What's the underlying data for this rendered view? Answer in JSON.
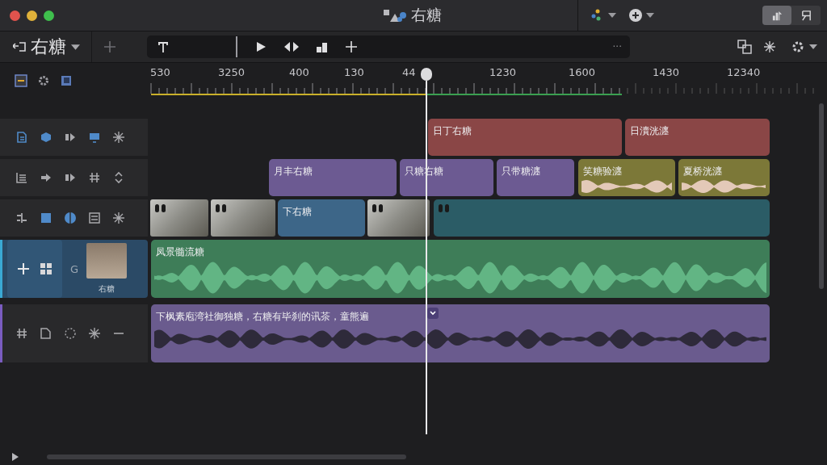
{
  "window": {
    "title": "右糖"
  },
  "title_bar": {
    "segments": [
      {
        "selected": true
      },
      {
        "selected": false
      }
    ]
  },
  "toolbar": {
    "project": "右糖",
    "more": "···"
  },
  "ruler": {
    "labels": [
      "530",
      "3250",
      "400",
      "130",
      "44",
      "1230",
      "1600",
      "1430",
      "12340"
    ]
  },
  "tracks": [
    {
      "kind": "title",
      "selected": false,
      "clips": [
        {
          "kind": "title",
          "label": "日丁右糖",
          "color": "#8a4646"
        },
        {
          "kind": "title",
          "label": "日瀆洸瀍",
          "color": "#8a4646"
        }
      ]
    },
    {
      "kind": "overlay",
      "selected": false,
      "clips": [
        {
          "kind": "title",
          "label": "月丰右糖",
          "color": "#6c5a92"
        },
        {
          "kind": "title",
          "label": "只糖右糖",
          "color": "#6c5a92"
        },
        {
          "kind": "title",
          "label": "只带糖瀍",
          "color": "#6c5a92"
        },
        {
          "kind": "audio",
          "label": "笑糖验瀍",
          "color": "#7c7838"
        },
        {
          "kind": "audio",
          "label": "夏桥洸瀍",
          "color": "#7c7838"
        }
      ]
    },
    {
      "kind": "video",
      "selected": false,
      "clips": [
        {
          "kind": "photo"
        },
        {
          "kind": "photo"
        },
        {
          "kind": "title",
          "label": "下右糖",
          "color": "#3d6688"
        },
        {
          "kind": "photo"
        },
        {
          "kind": "video",
          "color": "#2b5c66"
        }
      ]
    },
    {
      "kind": "music",
      "selected": true,
      "header": {
        "letter": "G",
        "caption": "右糖"
      },
      "clips": [
        {
          "kind": "audio",
          "label": "凤景髓流糖",
          "color": "#3e7d58"
        }
      ]
    },
    {
      "kind": "voice",
      "selected": false,
      "clips": [
        {
          "kind": "audio",
          "label": "下枫素庖湾社御独糖，右糖有毕刹的讯茶，童熊遍",
          "color": "#6a5b8e"
        }
      ]
    }
  ]
}
